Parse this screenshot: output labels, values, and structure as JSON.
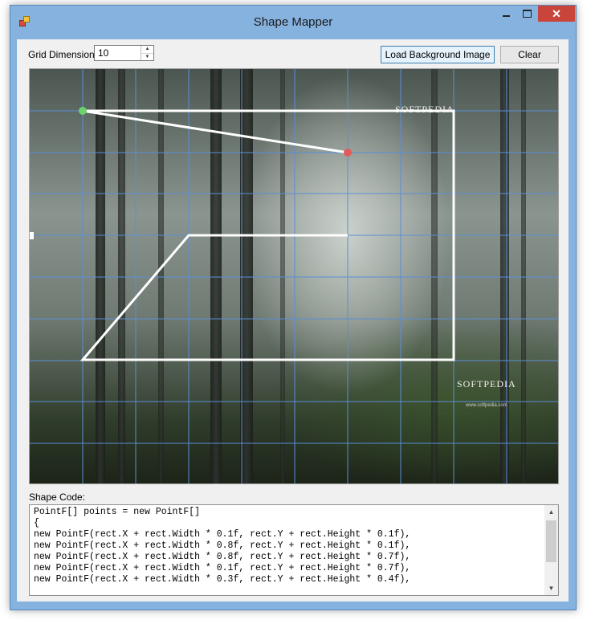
{
  "window": {
    "title": "Shape Mapper"
  },
  "toolbar": {
    "grid_dimension_label": "Grid Dimension",
    "grid_dimension_value": "10",
    "load_background_label": "Load Background Image",
    "clear_label": "Clear"
  },
  "canvas": {
    "grid_color": "#5b8ed6",
    "shape_color": "#ffffff",
    "start_point_color": "#6bd36b",
    "current_point_color": "#e05d5d",
    "watermark_1": "SOFTPEDIA",
    "watermark_2": "SOFTPEDIA",
    "watermark_url": "www.softpedia.com"
  },
  "code": {
    "label": "Shape Code:",
    "lines": [
      "PointF[] points = new PointF[]",
      "{",
      "new PointF(rect.X + rect.Width * 0.1f, rect.Y + rect.Height * 0.1f),",
      "new PointF(rect.X + rect.Width * 0.8f, rect.Y + rect.Height * 0.1f),",
      "new PointF(rect.X + rect.Width * 0.8f, rect.Y + rect.Height * 0.7f),",
      "new PointF(rect.X + rect.Width * 0.1f, rect.Y + rect.Height * 0.7f),",
      "new PointF(rect.X + rect.Width * 0.3f, rect.Y + rect.Height * 0.4f),"
    ]
  }
}
